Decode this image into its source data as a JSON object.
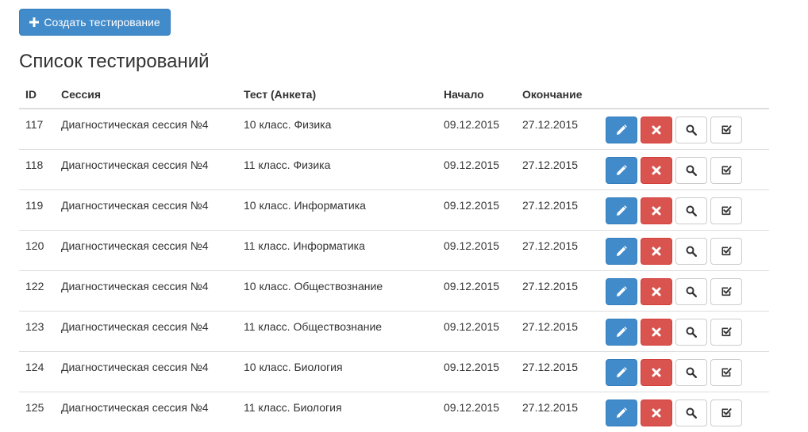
{
  "toolbar": {
    "create_label": "Создать тестирование"
  },
  "page": {
    "title": "Список тестирований"
  },
  "table": {
    "headers": [
      "ID",
      "Сессия",
      "Тест (Анкета)",
      "Начало",
      "Окончание",
      ""
    ],
    "rows": [
      {
        "id": "117",
        "session": "Диагностическая сессия №4",
        "test": "10 класс. Физика",
        "start": "09.12.2015",
        "end": "27.12.2015"
      },
      {
        "id": "118",
        "session": "Диагностическая сессия №4",
        "test": "11 класс. Физика",
        "start": "09.12.2015",
        "end": "27.12.2015"
      },
      {
        "id": "119",
        "session": "Диагностическая сессия №4",
        "test": "10 класс. Информатика",
        "start": "09.12.2015",
        "end": "27.12.2015"
      },
      {
        "id": "120",
        "session": "Диагностическая сессия №4",
        "test": "11 класс. Информатика",
        "start": "09.12.2015",
        "end": "27.12.2015"
      },
      {
        "id": "122",
        "session": "Диагностическая сессия №4",
        "test": "10 класс. Обществознание",
        "start": "09.12.2015",
        "end": "27.12.2015"
      },
      {
        "id": "123",
        "session": "Диагностическая сессия №4",
        "test": "11 класс. Обществознание",
        "start": "09.12.2015",
        "end": "27.12.2015"
      },
      {
        "id": "124",
        "session": "Диагностическая сессия №4",
        "test": "10 класс. Биология",
        "start": "09.12.2015",
        "end": "27.12.2015"
      },
      {
        "id": "125",
        "session": "Диагностическая сессия №4",
        "test": "11 класс. Биология",
        "start": "09.12.2015",
        "end": "27.12.2015"
      }
    ]
  },
  "row_actions": [
    {
      "name": "edit-button",
      "icon": "pencil-icon"
    },
    {
      "name": "delete-button",
      "icon": "close-icon"
    },
    {
      "name": "view-button",
      "icon": "search-icon"
    },
    {
      "name": "check-button",
      "icon": "check-circle-icon"
    }
  ],
  "colors": {
    "primary": "#428bca",
    "danger": "#d9534f",
    "border": "#dddddd",
    "text": "#333333"
  }
}
